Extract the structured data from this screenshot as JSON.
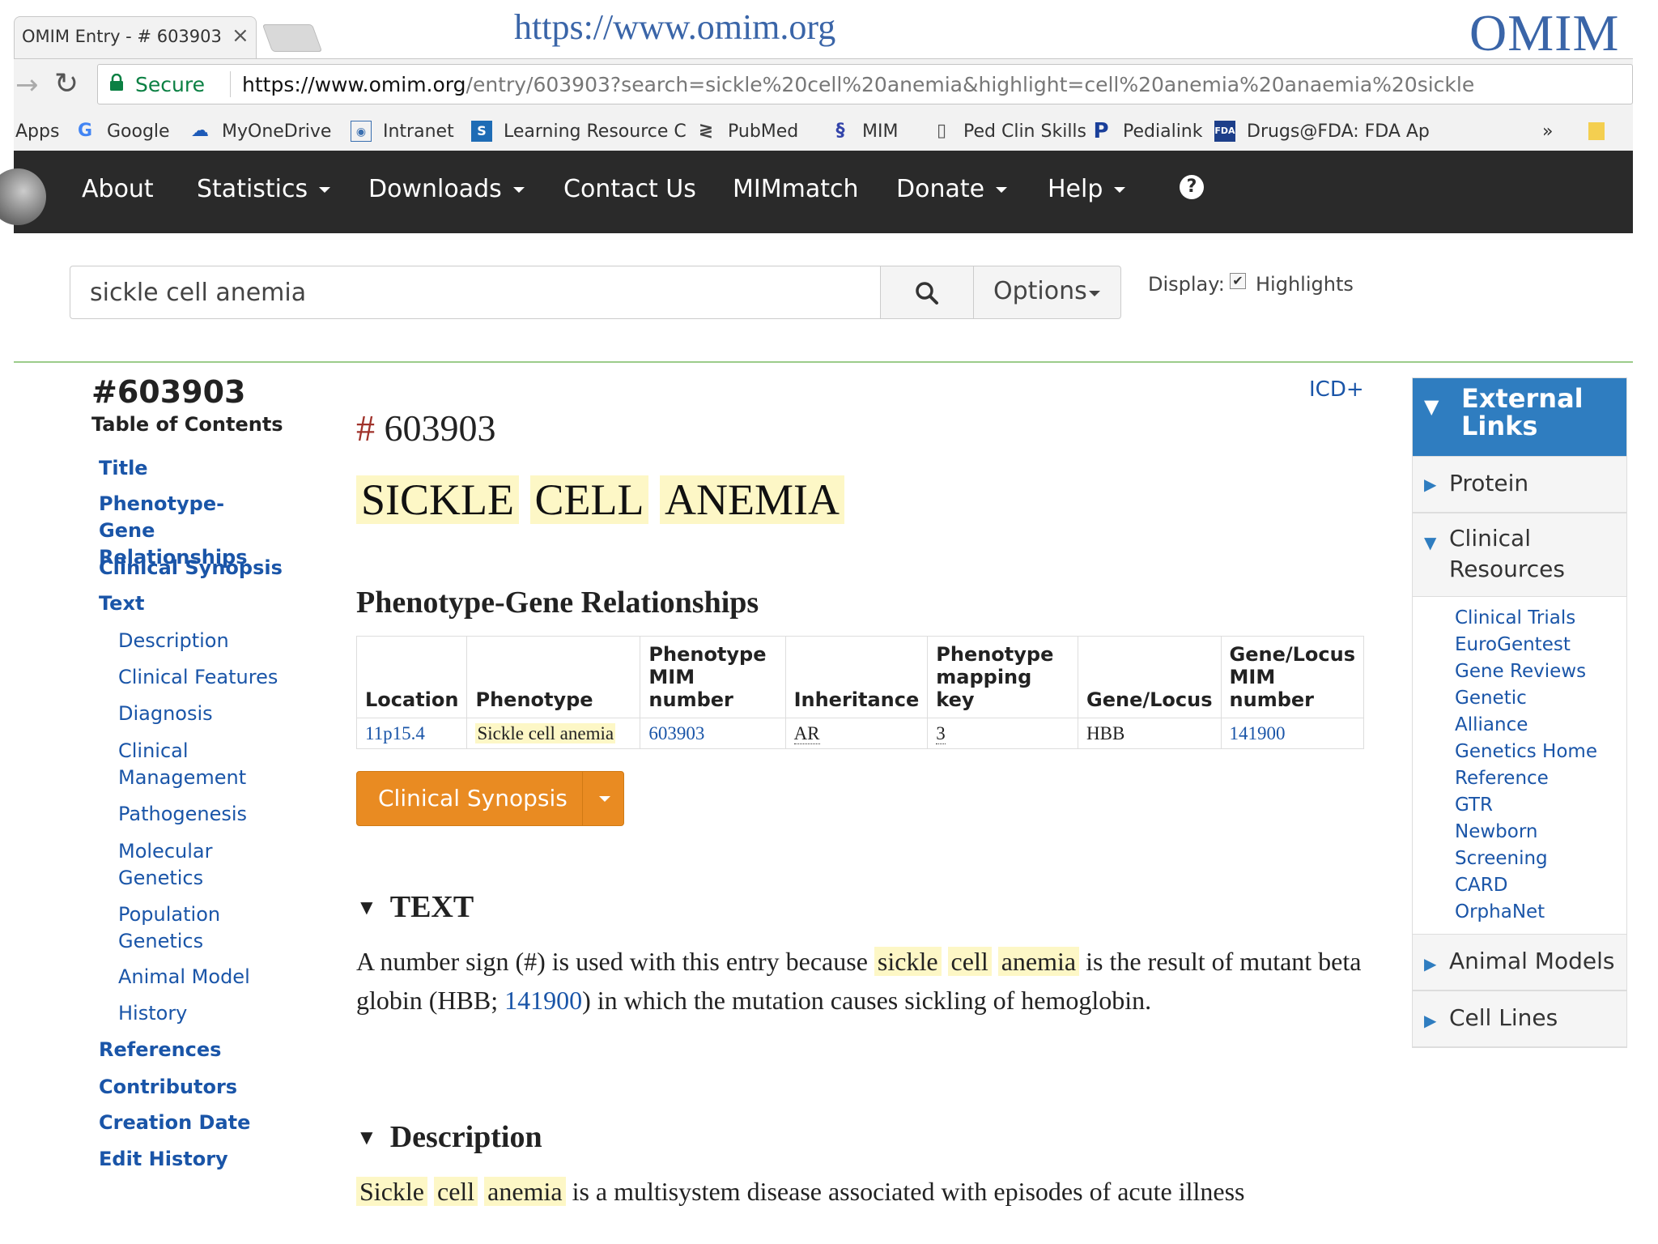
{
  "slide": {
    "url": "https://www.omim.org",
    "brand": "OMIM"
  },
  "browser": {
    "tab_title": "OMIM Entry - # 603903 -",
    "close_glyph": "×",
    "secure_label": "Secure",
    "url_domain": "https://www.omim.org",
    "url_rest": "/entry/603903?search=sickle%20cell%20anemia&highlight=cell%20anemia%20anaemia%20sickle",
    "bookmarks": [
      {
        "label": "Apps",
        "icon": "apps-icon"
      },
      {
        "label": "Google",
        "icon": "google-icon"
      },
      {
        "label": "MyOneDrive",
        "icon": "onedrive-icon"
      },
      {
        "label": "Intranet",
        "icon": "intranet-icon"
      },
      {
        "label": "Learning Resource C",
        "icon": "sharepoint-icon"
      },
      {
        "label": "PubMed",
        "icon": "pubmed-icon"
      },
      {
        "label": "MIM",
        "icon": "dna-icon"
      },
      {
        "label": "Ped Clin Skills",
        "icon": "page-icon"
      },
      {
        "label": "Pedialink",
        "icon": "pedialink-icon"
      },
      {
        "label": "Drugs@FDA: FDA Ap",
        "icon": "fda-icon"
      }
    ],
    "overflow": "»"
  },
  "nav": {
    "items": [
      {
        "label": "About",
        "dropdown": false
      },
      {
        "label": "Statistics",
        "dropdown": true
      },
      {
        "label": "Downloads",
        "dropdown": true
      },
      {
        "label": "Contact Us",
        "dropdown": false
      },
      {
        "label": "MIMmatch",
        "dropdown": false
      },
      {
        "label": "Donate",
        "dropdown": true
      },
      {
        "label": "Help",
        "dropdown": true
      }
    ],
    "help_icon": "?"
  },
  "search": {
    "value": "sickle cell anemia",
    "options_label": "Options",
    "display_label": "Display:",
    "highlights_label": "Highlights",
    "highlights_checked": true
  },
  "toc": {
    "entry_id": "#603903",
    "title": "Table of Contents",
    "items": [
      {
        "label": "Title",
        "level": 1
      },
      {
        "label": "Phenotype-Gene Relationships",
        "level": 1
      },
      {
        "label": "Clinical Synopsis",
        "level": 1
      },
      {
        "label": "Text",
        "level": 1
      },
      {
        "label": "Description",
        "level": 2
      },
      {
        "label": "Clinical Features",
        "level": 2
      },
      {
        "label": "Diagnosis",
        "level": 2
      },
      {
        "label": "Clinical Management",
        "level": 2
      },
      {
        "label": "Pathogenesis",
        "level": 2
      },
      {
        "label": "Molecular Genetics",
        "level": 2
      },
      {
        "label": "Population Genetics",
        "level": 2
      },
      {
        "label": "Animal Model",
        "level": 2
      },
      {
        "label": "History",
        "level": 2
      },
      {
        "label": "References",
        "level": 1
      },
      {
        "label": "Contributors",
        "level": 1
      },
      {
        "label": "Creation Date",
        "level": 1
      },
      {
        "label": "Edit History",
        "level": 1
      }
    ]
  },
  "entry": {
    "icd_label": "ICD+",
    "hash": "#",
    "number": "603903",
    "title_words": [
      "SICKLE",
      "CELL",
      "ANEMIA"
    ],
    "pgr_heading": "Phenotype-Gene Relationships",
    "table": {
      "headers": [
        "Location",
        "Phenotype",
        "Phenotype MIM number",
        "Inheritance",
        "Phenotype mapping key",
        "Gene/Locus",
        "Gene/Locus MIM number"
      ],
      "rows": [
        [
          "11p15.4",
          "Sickle cell anemia",
          "603903",
          "AR",
          "3",
          "HBB",
          "141900"
        ]
      ]
    },
    "clinical_synopsis_label": "Clinical Synopsis",
    "text_heading": "TEXT",
    "text_para": {
      "pre": "A number sign (#) is used with this entry because ",
      "hl1": "sickle",
      "hl2": "cell",
      "hl3": "anemia",
      "mid": " is the result of mutant beta globin (HBB; ",
      "link": "141900",
      "post": ") in which the mutation causes sickling of hemoglobin."
    },
    "description_heading": "Description",
    "description_para": {
      "hl1": "Sickle",
      "hl2": "cell",
      "hl3": "anemia",
      "post": " is a multisystem disease associated with episodes of acute illness"
    }
  },
  "external_links": {
    "title": "External Links",
    "sections": [
      {
        "label": "Protein",
        "expanded": false
      },
      {
        "label": "Clinical Resources",
        "expanded": true
      },
      {
        "label": "Animal Models",
        "expanded": false
      },
      {
        "label": "Cell Lines",
        "expanded": false
      }
    ],
    "clinical_links": [
      "Clinical Trials",
      "EuroGentest",
      "Gene Reviews",
      "Genetic Alliance",
      "Genetics Home Reference",
      "GTR",
      "Newborn Screening",
      "CARD",
      "OrphaNet"
    ],
    "expanded_glyph": "▼",
    "collapsed_glyph": "▶"
  }
}
